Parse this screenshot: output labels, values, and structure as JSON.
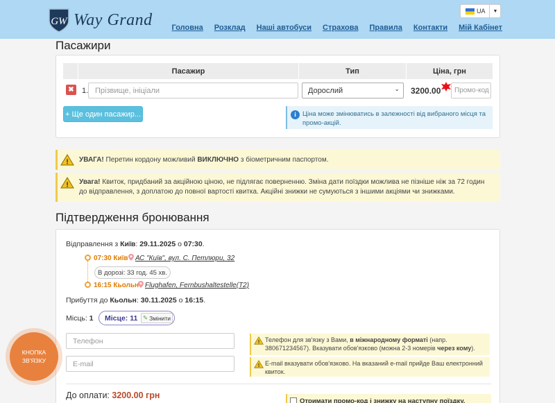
{
  "header": {
    "logo_text": "Way Grand",
    "nav": [
      "Головна",
      "Розклад",
      "Наші автобуси",
      "Страхова",
      "Правила",
      "Контакти",
      "Мій Кабінет"
    ],
    "lang_code": "UA"
  },
  "passengers": {
    "title": "Пасажири",
    "columns": {
      "passenger": "Пасажир",
      "type": "Тип",
      "price": "Ціна, грн"
    },
    "row": {
      "number": "1.",
      "name_placeholder": "Прізвище, ініціали",
      "type_value": "Дорослий",
      "price": "3200.00",
      "promo_placeholder": "Промо-код"
    },
    "add_button": "+ Ще один пасажир...",
    "price_note": "Ціна може змінюватись в залежності від вибраного місця та промо-акцій."
  },
  "warnings": {
    "border_bold": "УВАГА!",
    "border_text_1": " Перетин кордону можливий ",
    "border_text_bold": "ВИКЛЮЧНО",
    "border_text_2": " з біометричним паспортом.",
    "promo_bold": "Увага!",
    "promo_text": " Квиток, придбаний за акційною ціною, не підлягає поверненню. Зміна дати поїздки можлива не пізніше ніж за 72 годин до відправлення, з доплатою до повної вартості квитка. Акційні знижки не сумуються з іншими акціями чи знижками."
  },
  "confirmation": {
    "title": "Підтвердження бронювання",
    "departure_label": "Відправлення з ",
    "departure_city": "Київ",
    "departure_date": "29.11.2025",
    "at": " о ",
    "departure_time": "07:30",
    "stop1_time": "07:30 Київ",
    "stop1_addr": "АС \"Київ\", вул. С. Петлюри, 32",
    "duration": "В дорозі: 33 год. 45 хв.",
    "stop2_time": "16:15 Кьольн",
    "stop2_addr": "Flughafen, Fernbushaltestelle(T2)",
    "arrival_label": "Прибуття до ",
    "arrival_city": "Кьольн",
    "arrival_date": "30.11.2025",
    "arrival_time": "16:15",
    "seats_label": "Місць:",
    "seats_count": "1",
    "seat_pill": "Місце: 11",
    "change_label": "Змінити",
    "phone_placeholder": "Телефон",
    "email_placeholder": "E-mail",
    "phone_note_1": "Телефон для зв'язку з Вами, ",
    "phone_note_bold": "в міжнародному форматі",
    "phone_note_2": " (напр. 380671234567). Вказувати обов'язково (можна 2-3 номерів ",
    "phone_note_bold2": "через кому",
    "phone_note_3": ").",
    "email_note": "E-mail вказувати обов'язково. На вказаний e-mail прийде Ваш електронний квиток.",
    "total_label": "До оплати: ",
    "total_value": "3200.00 грн",
    "promo_checkbox": "Отримати промо-код і знижку на наступну поїздку."
  },
  "callback_button": "КНОПКА ЗВ'ЯЗКУ",
  "colors": {
    "header": "#aed8f3",
    "accent": "#5bc0de",
    "warning": "#fcf8d6",
    "route": "#f0a02c",
    "callback": "#e8813d"
  }
}
